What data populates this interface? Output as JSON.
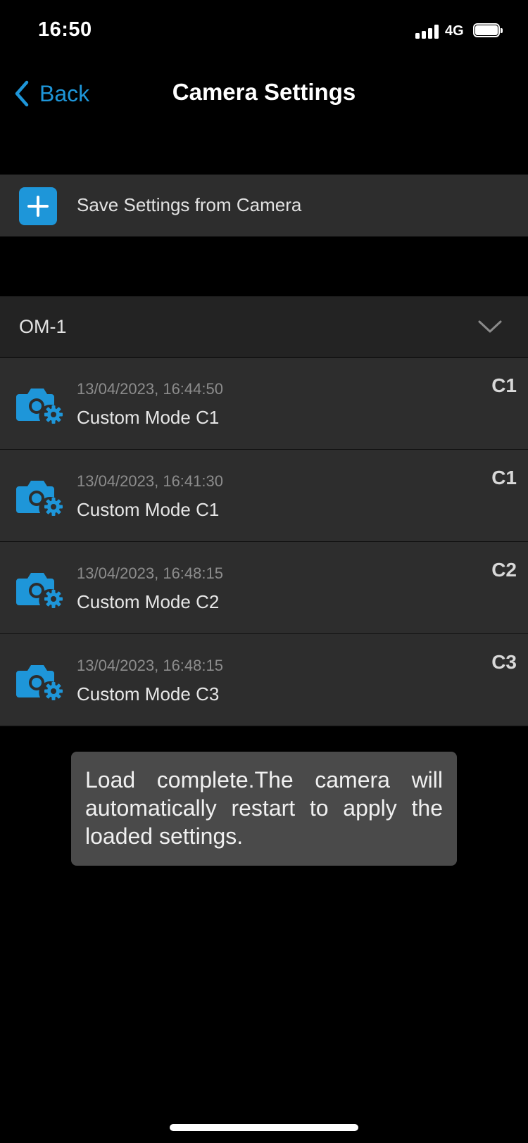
{
  "status_bar": {
    "time": "16:50",
    "network": "4G",
    "signal_bars": 4,
    "battery_level": 1.0,
    "icons": [
      "signal-icon",
      "battery-icon"
    ]
  },
  "nav": {
    "back_label": "Back",
    "title": "Camera Settings",
    "back_icon": "chevron-left-icon"
  },
  "save_row": {
    "label": "Save Settings from Camera",
    "icon": "plus-icon"
  },
  "group": {
    "label": "OM-1",
    "icon": "chevron-down-icon"
  },
  "items": [
    {
      "timestamp": "13/04/2023, 16:44:50",
      "name": "Custom Mode C1",
      "mode": "C1"
    },
    {
      "timestamp": "13/04/2023, 16:41:30",
      "name": "Custom Mode C1",
      "mode": "C1"
    },
    {
      "timestamp": "13/04/2023, 16:48:15",
      "name": "Custom Mode C2",
      "mode": "C2"
    },
    {
      "timestamp": "13/04/2023, 16:48:15",
      "name": "Custom Mode C3",
      "mode": "C3"
    }
  ],
  "item_icon": "camera-settings-icon",
  "toast": {
    "message": "Load complete.The camera will automatically restart to apply the loaded settings."
  },
  "colors": {
    "accent": "#1e96d9",
    "background": "#000000",
    "row": "#2d2d2d",
    "header": "#232323",
    "toast": "#4a4a4a"
  }
}
